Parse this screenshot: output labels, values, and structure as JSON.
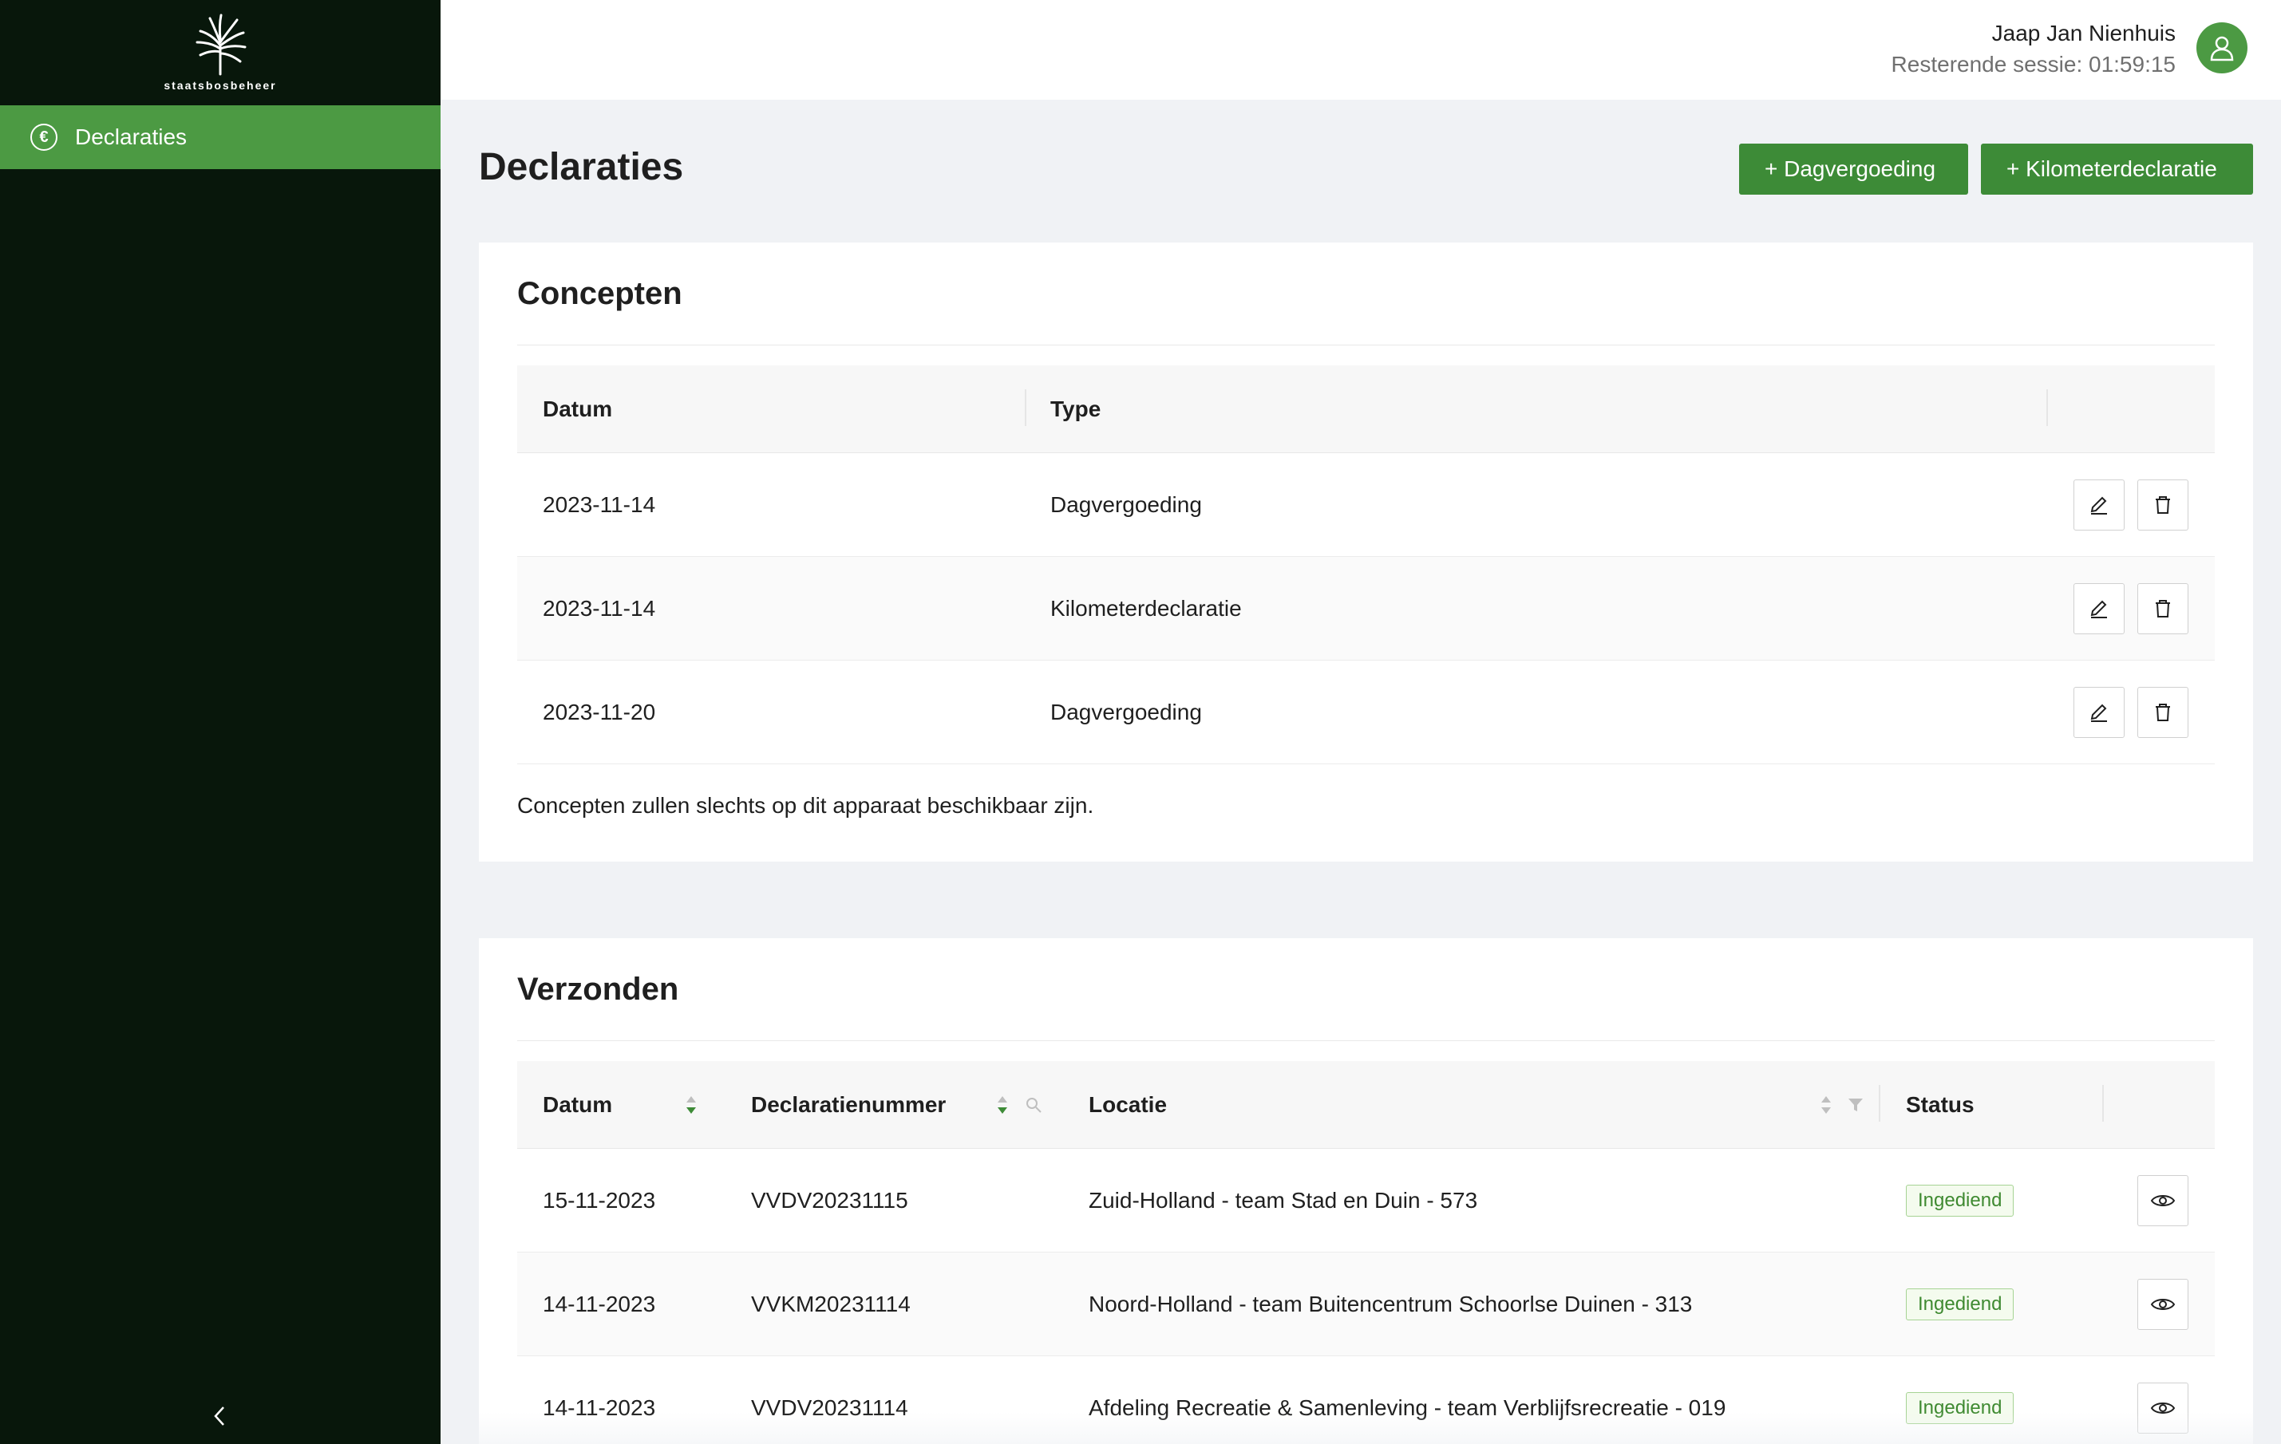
{
  "brand": {
    "logo_text": "staatsbosbeheer"
  },
  "sidebar": {
    "items": [
      {
        "label": "Declaraties",
        "icon": "euro-icon"
      }
    ],
    "collapse_icon": "chevron-left-icon"
  },
  "header": {
    "user_name": "Jaap Jan Nienhuis",
    "session": "Resterende sessie: 01:59:15",
    "avatar_icon": "user-icon"
  },
  "page": {
    "title": "Declaraties",
    "buttons": {
      "dagvergoeding": "+ Dagvergoeding",
      "kilometerdeclaratie": "+ Kilometerdeclaratie"
    }
  },
  "concepts": {
    "title": "Concepten",
    "columns": {
      "datum": "Datum",
      "type": "Type"
    },
    "rows": [
      {
        "datum": "2023-11-14",
        "type": "Dagvergoeding"
      },
      {
        "datum": "2023-11-14",
        "type": "Kilometerdeclaratie"
      },
      {
        "datum": "2023-11-20",
        "type": "Dagvergoeding"
      }
    ],
    "note": "Concepten zullen slechts op dit apparaat beschikbaar zijn."
  },
  "sent": {
    "title": "Verzonden",
    "columns": {
      "datum": "Datum",
      "nummer": "Declaratienummer",
      "locatie": "Locatie",
      "status": "Status"
    },
    "rows": [
      {
        "datum": "15-11-2023",
        "nummer": "VVDV20231115",
        "locatie": "Zuid-Holland - team Stad en Duin - 573",
        "status": "Ingediend"
      },
      {
        "datum": "14-11-2023",
        "nummer": "VVKM20231114",
        "locatie": "Noord-Holland - team Buitencentrum Schoorlse Duinen - 313",
        "status": "Ingediend"
      },
      {
        "datum": "14-11-2023",
        "nummer": "VVDV20231114",
        "locatie": "Afdeling Recreatie & Samenleving - team Verblijfsrecreatie - 019",
        "status": "Ingediend"
      }
    ]
  },
  "colors": {
    "sidebar_bg": "#08170b",
    "accent": "#4c9a43",
    "button": "#3d8b37",
    "badge_text": "#3f8a31"
  }
}
